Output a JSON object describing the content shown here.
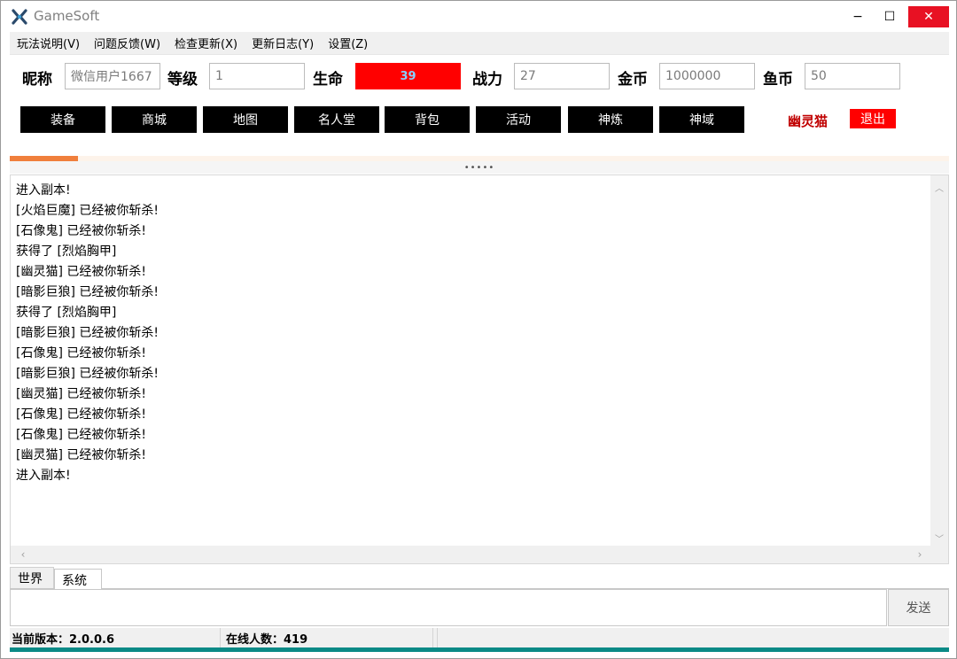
{
  "window": {
    "title": "GameSoft",
    "minimize": "−",
    "maximize": "☐",
    "close": "✕"
  },
  "menu": [
    "玩法说明(V)",
    "问题反馈(W)",
    "检查更新(X)",
    "更新日志(Y)",
    "设置(Z)"
  ],
  "player": {
    "nickname_label": "昵称",
    "nickname": "微信用户1667",
    "level_label": "等级",
    "level": "1",
    "hp_label": "生命",
    "hp": "39",
    "power_label": "战力",
    "power": "27",
    "gold_label": "金币",
    "gold": "1000000",
    "fish_label": "鱼币",
    "fish": "50"
  },
  "nav_buttons": [
    "装备",
    "商城",
    "地图",
    "名人堂",
    "背包",
    "活动",
    "神炼",
    "神域"
  ],
  "pet_name": "幽灵猫",
  "exit_label": "退出",
  "splitter_label": "•••••",
  "progress": 0.073,
  "log": [
    "进入副本!",
    "[火焰巨魔] 已经被你斩杀!",
    "[石像鬼] 已经被你斩杀!",
    "获得了 [烈焰胸甲]",
    "[幽灵猫] 已经被你斩杀!",
    "[暗影巨狼] 已经被你斩杀!",
    "获得了 [烈焰胸甲]",
    "[暗影巨狼] 已经被你斩杀!",
    "[石像鬼] 已经被你斩杀!",
    "[暗影巨狼] 已经被你斩杀!",
    "[幽灵猫] 已经被你斩杀!",
    "[石像鬼] 已经被你斩杀!",
    "[石像鬼] 已经被你斩杀!",
    "[幽灵猫] 已经被你斩杀!",
    "进入副本!"
  ],
  "tabs": [
    "世界",
    "系统"
  ],
  "send_label": "发送",
  "status": {
    "version": "当前版本：2.0.0.6",
    "online": "在线人数：419"
  },
  "colors": {
    "hp_bg": "#ff0000",
    "accent_orange": "#f07f3c",
    "bottom_bar": "#0a8a86",
    "pet_name": "#c00000"
  }
}
